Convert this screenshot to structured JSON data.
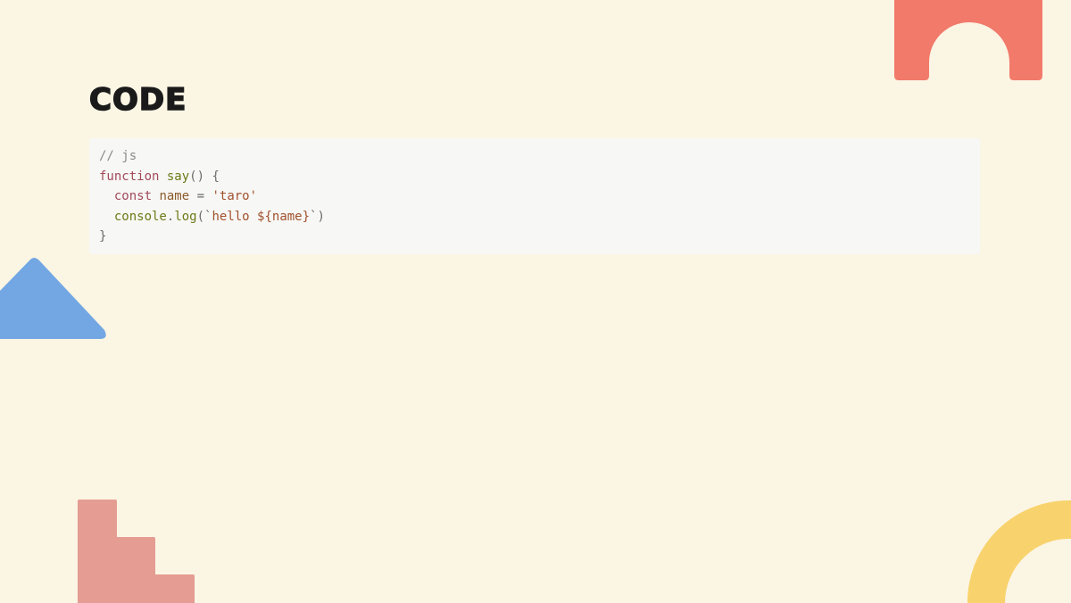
{
  "slide": {
    "title": "CODE"
  },
  "code": {
    "language": "js",
    "lines": [
      [
        {
          "type": "comment",
          "text": "// js"
        }
      ],
      [
        {
          "type": "keyword",
          "text": "function"
        },
        {
          "type": "punct",
          "text": " "
        },
        {
          "type": "func",
          "text": "say"
        },
        {
          "type": "punct",
          "text": "() {"
        }
      ],
      [
        {
          "type": "punct",
          "text": "  "
        },
        {
          "type": "keyword",
          "text": "const"
        },
        {
          "type": "punct",
          "text": " "
        },
        {
          "type": "ident",
          "text": "name"
        },
        {
          "type": "op",
          "text": " = "
        },
        {
          "type": "string",
          "text": "'taro'"
        }
      ],
      [
        {
          "type": "punct",
          "text": "  "
        },
        {
          "type": "func",
          "text": "console"
        },
        {
          "type": "punct",
          "text": "."
        },
        {
          "type": "func",
          "text": "log"
        },
        {
          "type": "punct",
          "text": "(`"
        },
        {
          "type": "string",
          "text": "hello ${name}"
        },
        {
          "type": "punct",
          "text": "`)"
        }
      ],
      [
        {
          "type": "punct",
          "text": "}"
        }
      ]
    ]
  },
  "decorations": {
    "arch_top": {
      "icon": "arch-shape",
      "color": "#f27a6a"
    },
    "triangle": {
      "icon": "triangle-shape",
      "color": "#72a7e3"
    },
    "stairs": {
      "icon": "stairs-shape",
      "color": "#e59c93"
    },
    "arch_yellow": {
      "icon": "ring-arc-shape",
      "color": "#f8d36d"
    }
  }
}
